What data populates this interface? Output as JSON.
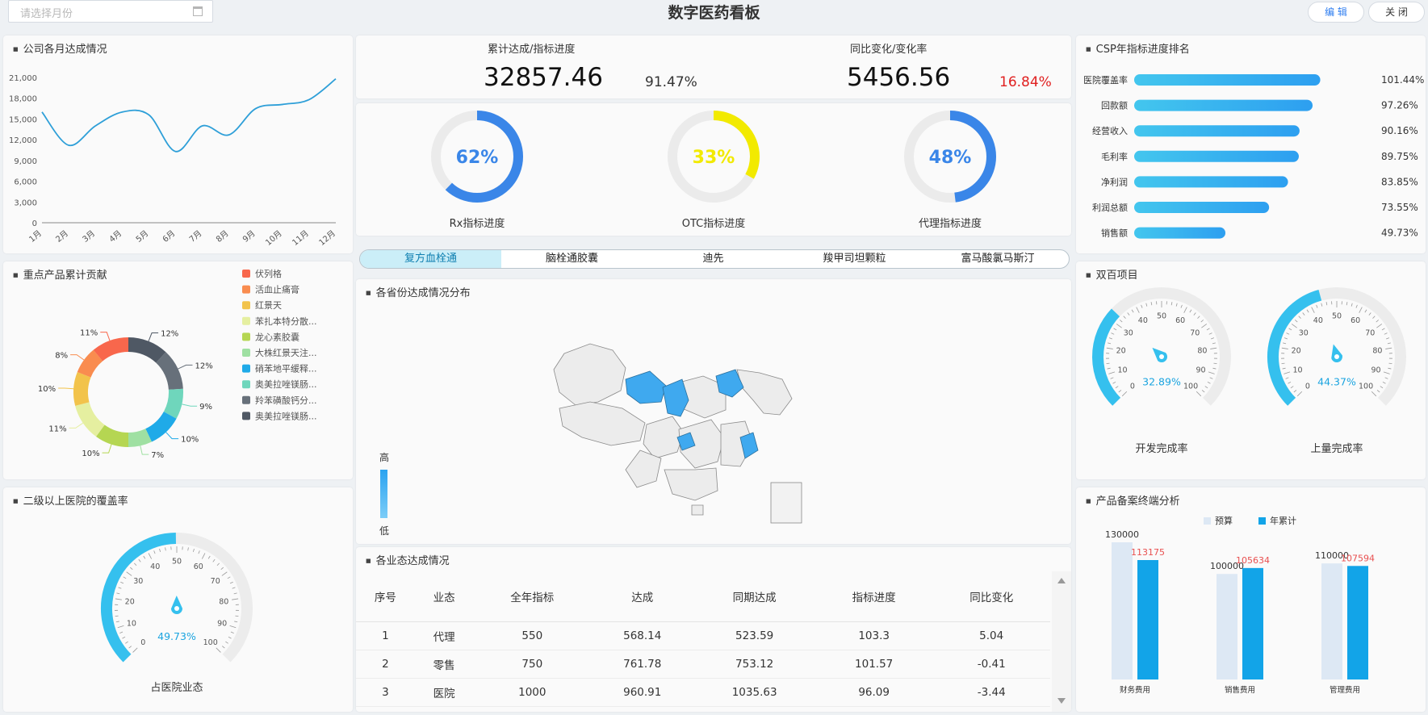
{
  "header": {
    "month_placeholder": "请选择月份",
    "title": "数字医药看板",
    "edit_label": "编 辑",
    "close_label": "关 闭"
  },
  "monthly": {
    "title": "公司各月达成情况",
    "chart_data": {
      "type": "line",
      "x": [
        "1月",
        "2月",
        "3月",
        "4月",
        "5月",
        "6月",
        "7月",
        "8月",
        "9月",
        "10月",
        "11月",
        "12月"
      ],
      "y_ticks": [
        "0",
        "3,000",
        "6,000",
        "9,000",
        "12,000",
        "15,000",
        "18,000",
        "21,000"
      ],
      "ylim": [
        0,
        21000
      ],
      "values": [
        16000,
        11200,
        14000,
        16000,
        15600,
        10300,
        14000,
        12700,
        16500,
        17100,
        17800,
        20800
      ],
      "color": "#2e9fd8"
    }
  },
  "kpi": {
    "cum_label": "累计达成/指标进度",
    "cum_value": "32857.46",
    "cum_pct": "91.47%",
    "yoy_label": "同比变化/变化率",
    "yoy_value": "5456.56",
    "yoy_pct": "16.84%",
    "yoy_color": "#e02020"
  },
  "rings": [
    {
      "pct_text": "62%",
      "value": 62,
      "label": "Rx指标进度",
      "color": "#3a86e8"
    },
    {
      "pct_text": "33%",
      "value": 33,
      "label": "OTC指标进度",
      "color": "#f2ea00"
    },
    {
      "pct_text": "48%",
      "value": 48,
      "label": "代理指标进度",
      "color": "#3a86e8"
    }
  ],
  "csp": {
    "title": "CSP年指标进度排名",
    "chart_data": {
      "type": "bar",
      "categories": [
        "医院覆盖率",
        "回款额",
        "经营收入",
        "毛利率",
        "净利润",
        "利润总额",
        "销售额"
      ],
      "values": [
        101.44,
        97.26,
        90.16,
        89.75,
        83.85,
        73.55,
        49.73
      ],
      "labels": [
        "101.44%",
        "97.26%",
        "90.16%",
        "89.75%",
        "83.85%",
        "73.55%",
        "49.73%"
      ],
      "color": "#3ac4ee"
    }
  },
  "products": {
    "title": "重点产品累计贡献",
    "chart_data": {
      "type": "pie",
      "categories": [
        "伏列格",
        "活血止痛膏",
        "红景天",
        "苯扎本特分散...",
        "龙心素胶囊",
        "大株红景天注...",
        "硝苯地平缓释...",
        "奥美拉唑镁肠...",
        "羚苯磺酸钙分...",
        "奥美拉唑镁肠..."
      ],
      "values": [
        11,
        8,
        10,
        11,
        10,
        7,
        10,
        9,
        12,
        12
      ],
      "labels": [
        "11%",
        "8%",
        "10%",
        "11%",
        "10%",
        "7%",
        "10%",
        "9%",
        "12%",
        "12%"
      ],
      "colors": [
        "#f8674c",
        "#f98c4f",
        "#f2c34b",
        "#e5efa0",
        "#b5d652",
        "#9fe0a2",
        "#1faae8",
        "#6fd6bc",
        "#67707a",
        "#4f5864"
      ]
    }
  },
  "tabs": [
    "复方血栓通",
    "脑栓通胶囊",
    "迪先",
    "羧甲司坦颗粒",
    "富马酸氯马斯汀"
  ],
  "map": {
    "title": "各省份达成情况分布",
    "legend_high": "高",
    "legend_low": "低",
    "highlight_color": "#3fa9ef"
  },
  "double": {
    "title": "双百项目",
    "gauges": [
      {
        "value": 32.89,
        "text": "32.89%",
        "label": "开发完成率"
      },
      {
        "value": 44.37,
        "text": "44.37%",
        "label": "上量完成率"
      }
    ]
  },
  "coverage": {
    "title": "二级以上医院的覆盖率",
    "gauge": {
      "value": 49.73,
      "text": "49.73%",
      "label": "占医院业态"
    }
  },
  "gauge_ticks": [
    "0",
    "10",
    "20",
    "30",
    "40",
    "50",
    "60",
    "70",
    "80",
    "90",
    "100"
  ],
  "biz": {
    "title": "各业态达成情况",
    "headers": [
      "序号",
      "业态",
      "全年指标",
      "达成",
      "同期达成",
      "指标进度",
      "同比变化"
    ],
    "rows": [
      [
        "1",
        "代理",
        "550",
        "568.14",
        "523.59",
        "103.3",
        "5.04"
      ],
      [
        "2",
        "零售",
        "750",
        "761.78",
        "753.12",
        "101.57",
        "-0.41"
      ],
      [
        "3",
        "医院",
        "1000",
        "960.91",
        "1035.63",
        "96.09",
        "-3.44"
      ]
    ]
  },
  "terminal": {
    "title": "产品备案终端分析",
    "chart_data": {
      "type": "bar",
      "categories": [
        "财务费用",
        "销售费用",
        "管理费用"
      ],
      "series": [
        {
          "name": "预算",
          "values": [
            130000,
            100000,
            110000
          ],
          "color": "#dde8f4"
        },
        {
          "name": "年累计",
          "values": [
            113175,
            105634,
            107594
          ],
          "color": "#12a4e8"
        }
      ],
      "label_color": "#e85050"
    }
  }
}
